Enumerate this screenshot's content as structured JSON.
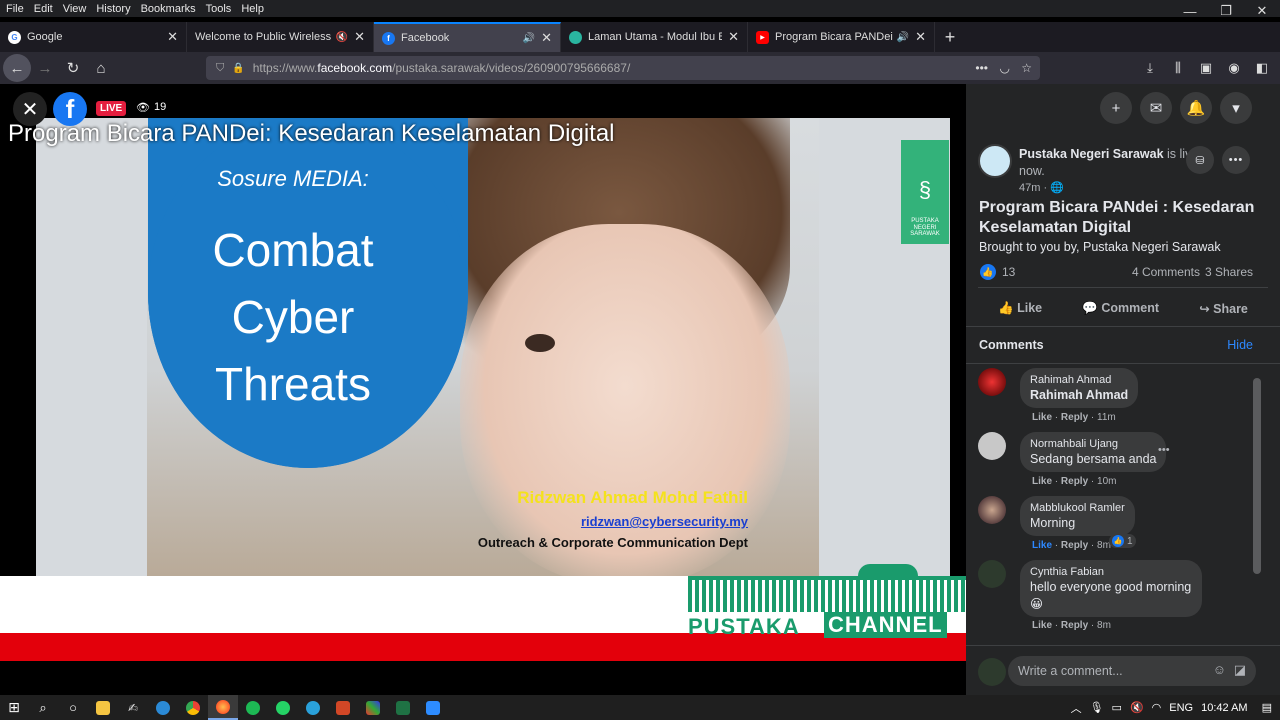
{
  "menu": [
    "File",
    "Edit",
    "View",
    "History",
    "Bookmarks",
    "Tools",
    "Help"
  ],
  "window_controls": {
    "minimize": "—",
    "restore": "❐",
    "close": "✕"
  },
  "tabs": [
    {
      "title": "Google",
      "icon": "google-icon",
      "color": "#4285f4",
      "letter": "G"
    },
    {
      "title": "Welcome to Public Wireless Net",
      "icon": "mute-icon",
      "color": "#888",
      "letter": ""
    },
    {
      "title": "Facebook",
      "icon": "facebook-icon",
      "color": "#1877f2",
      "letter": "f"
    },
    {
      "title": "Laman Utama - Modul Ibu Bap",
      "icon": "page-icon",
      "color": "#2ab5a0",
      "letter": ""
    },
    {
      "title": "Program Bicara PANDei : Ke",
      "icon": "youtube-icon",
      "color": "#ff0000",
      "letter": "▶"
    }
  ],
  "new_tab": "+",
  "url": {
    "prefix": "https://www.",
    "host": "facebook.com",
    "path": "/pustaka.sarawak/videos/260900795666687/"
  },
  "video": {
    "live_label": "LIVE",
    "viewers": "19",
    "overlay_title": "Program Bicara PANDei: Kesedaran Keselamatan Digital",
    "slide_brand": "Sosure MEDIA:",
    "slide_lines": [
      "Combat",
      "Cyber",
      "Threats"
    ],
    "speaker_name": "Ridzwan Ahmad Mohd Fathil",
    "speaker_email": "ridzwan@cybersecurity.my",
    "speaker_dept": "Outreach & Corporate Communication Dept",
    "logo_text": [
      "PUSTAKA",
      "NEGERI",
      "SARAWAK"
    ],
    "channel_left": "PUSTAKA",
    "channel_right": "CHANNEL"
  },
  "post": {
    "page_name": "Pustaka Negeri Sarawak",
    "status_suffix": "is live now.",
    "time": "47m · ",
    "title": "Program Bicara PANdei : Kesedaran Keselamatan Digital",
    "description": "Brought to you by, Pustaka Negeri Sarawak",
    "likes": "13",
    "comments_count": "4 Comments",
    "shares_count": "3 Shares",
    "actions": [
      "Like",
      "Comment",
      "Share"
    ]
  },
  "comments_header": "Comments",
  "hide_label": "Hide",
  "comments": [
    {
      "name": "Rahimah Ahmad",
      "text": "Rahimah Ahmad",
      "like": "Like",
      "reply": "Reply",
      "time": "11m",
      "avatar": "#a11a1a"
    },
    {
      "name": "Normahbali Ujang",
      "text": "Sedang bersama anda",
      "like": "Like",
      "reply": "Reply",
      "time": "10m",
      "avatar": "#c8c8c8"
    },
    {
      "name": "Mabblukool Ramler",
      "text": "Morning",
      "like": "Like",
      "reply": "Reply",
      "time": "8m",
      "avatar": "#8a6a6a",
      "reactions": "1"
    },
    {
      "name": "Cynthia Fabian",
      "text": "hello everyone good morning",
      "like": "Like",
      "reply": "Reply",
      "time": "8m",
      "avatar": "#2d3a2d",
      "emoji": "😀"
    }
  ],
  "write_placeholder": "Write a comment...",
  "taskbar": {
    "lang": "ENG",
    "time": "10:42 AM"
  }
}
